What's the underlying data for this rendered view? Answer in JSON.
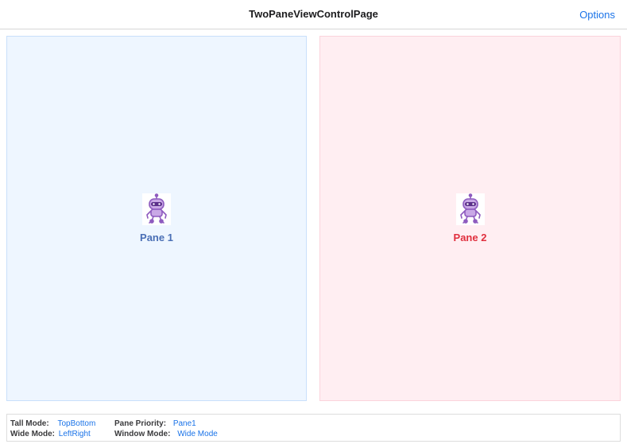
{
  "navbar": {
    "title": "TwoPaneViewControlPage",
    "options_label": "Options"
  },
  "panes": [
    {
      "label": "Pane 1",
      "icon": "robot-icon",
      "background": "#eef6ff",
      "label_color": "#4a6fb5"
    },
    {
      "label": "Pane 2",
      "icon": "robot-icon",
      "background": "#ffeef2",
      "label_color": "#e0303f"
    }
  ],
  "status": {
    "tall_mode_label": "Tall Mode:",
    "tall_mode_value": "TopBottom",
    "pane_priority_label": "Pane Priority:",
    "pane_priority_value": "Pane1",
    "wide_mode_label": "Wide Mode:",
    "wide_mode_value": "LeftRight",
    "window_mode_label": "Window Mode:",
    "window_mode_value": "Wide Mode"
  },
  "colors": {
    "accent": "#1a73e8",
    "robot": "#8e5bbf"
  }
}
